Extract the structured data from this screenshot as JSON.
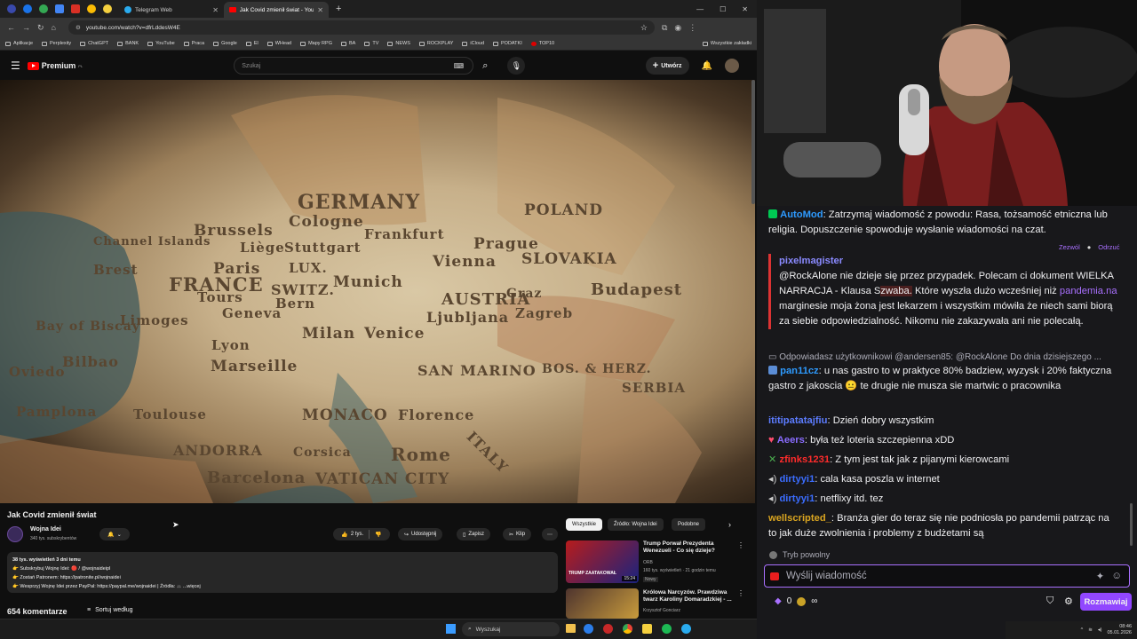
{
  "browser": {
    "tabs": [
      {
        "label": "Telegram Web"
      },
      {
        "label": "Jak Covid zmienił świat - YouTu..."
      }
    ],
    "new_tab": "+",
    "url": "youtube.com/watch?v=dfrLddesW4E",
    "bookmarks": [
      "Aplikacje",
      "Perplexity",
      "ChatGPT",
      "BANK",
      "YouTube",
      "Praca",
      "Google",
      "El",
      "WHead",
      "Mapy RPG",
      "BA",
      "TV",
      "NEWS",
      "ROCKPLAY",
      "iCloud",
      "PODATKI",
      "TOP10"
    ],
    "all_bookmarks": "Wszystkie zakładki"
  },
  "youtube": {
    "brand": "Premium",
    "brand_sup": "PL",
    "search_placeholder": "Szukaj",
    "create_label": "Utwórz",
    "map_labels": [
      "GERMANY",
      "Cologne",
      "Frankfurt",
      "Brussels",
      "Stuttgart",
      "Munich",
      "Paris",
      "FRANCE",
      "Tours",
      "Limoges",
      "Vienna",
      "Prague",
      "POLAND",
      "SLOVAKIA",
      "Budapest",
      "AUSTRIA",
      "SWITZ.",
      "Geneva",
      "Bern",
      "Milan",
      "Venice",
      "Ljubljana",
      "Zagreb",
      "Graz",
      "Marseille",
      "MONACO",
      "SAN MARINO",
      "Florence",
      "ANDORRA",
      "Barcelona",
      "VATICAN CITY",
      "Rome",
      "Corsica",
      "BOS. & HERZ.",
      "SERBIA",
      "ITALY",
      "Bilbao",
      "Oviedo",
      "Pamplona",
      "Bay of Biscay",
      "Brest",
      "Channel Islands",
      "Lyon",
      "Toulouse",
      "LUX.",
      "Liège"
    ],
    "video_title": "Jak Covid zmienił świat",
    "channel": "Wojna Idei",
    "subscribers": "340 tys. subskrybentów",
    "likes": "2 tys.",
    "share": "Udostępnij",
    "save": "Zapisz",
    "clip": "Klip",
    "views_line": "38 tys. wyświetleń  3 dni temu",
    "desc_lines": [
      "👉 Subskrybuj Wojnę Idei: 🔴 / @wojnaideipl",
      "👉 Zostań Patronem: https://patronite.pl/wojnaidei",
      "👉 Wesprzyj Wojnę Idei przez PayPal: https://paypal.me/wojnaidei   |   Źródła: ↓↓ ...więcej"
    ],
    "comments_count": "654 komentarze",
    "sort_label": "Sortuj według",
    "chips": [
      "Wszystkie",
      "Źródło: Wojna Idei",
      "Podobne"
    ],
    "related": [
      {
        "title": "Trump Porwał Prezydenta Wenezueli - Co się dzieje?",
        "channel": "ORB",
        "meta": "160 tys. wyświetleń · 21 godzin temu",
        "badge": "Nowy",
        "duration": "15:24",
        "thumb_text": "TRUMP ZAATAKOWAŁ"
      },
      {
        "title": "Królowa Narcyzów. Prawdziwa twarz Karoliny Domaradzkiej - ...",
        "channel": "Krzysztof Gonciarz",
        "meta": "",
        "badge": "",
        "duration": "",
        "thumb_text": ""
      }
    ]
  },
  "chat": {
    "automod": {
      "name": "AutoMod",
      "text": ": Zatrzymaj wiadomość z powodu: Rasa, tożsamość etniczna lub religia. Dopuszczenie spowoduje wysłanie wiadomości na czat.",
      "allow": "Zezwól",
      "deny": "Odrzuć"
    },
    "held": {
      "name": "pixelmagister",
      "text1": "@RockAlone nie dzieje się przez przypadek. Polecam ci dokument WIELKA NARRACJA - Klausa S",
      "highlight1": "zwaba.",
      "text2": " Które wyszła dużo wcześniej niż ",
      "highlight2": "pandemia.na",
      "text3": " marginesie moja żona jest lekarzem i wszystkim mówiła że niech sami biorą za siebie odpowiedzialność. Nikomu nie zakazywała ani nie polecałą."
    },
    "reply_ctx": "Odpowiadasz użytkownikowi @andersen85: @RockAlone Do dnia dzisiejszego ...",
    "messages": [
      {
        "name": "pan11cz",
        "color": "#2e9bff",
        "text": ": u nas gastro to w praktyce 80% badziew, wyzysk i 20% faktyczna gastro z jakoscia 😐 te drugie nie musza sie martwic o pracownika"
      },
      {
        "name": "ititipatatajfiu",
        "color": "#5c7cff",
        "text": ": Dzień dobry wszystkim"
      },
      {
        "name": "Aeers",
        "color": "#8a6cff",
        "text": ": była też loteria szczepienna xDD"
      },
      {
        "name": "zfinks1231",
        "color": "#ff2b2b",
        "text": ": Z tym jest tak jak z pijanymi kierowcami"
      },
      {
        "name": "dirtyyi1",
        "color": "#3b6dff",
        "text": ": cala kasa poszla w internet"
      },
      {
        "name": "dirtyyi1",
        "color": "#3b6dff",
        "text": ": netflixy itd. tez"
      },
      {
        "name": "wellscripted_",
        "color": "#daa520",
        "text": ": Branża gier do teraz się nie podniosła po pandemii patrząc na to jak duże zwolnienia i problemy z budżetami są"
      }
    ],
    "slow_mode": "Tryb powolny",
    "input_placeholder": "Wyślij wiadomość",
    "points": "0",
    "chat_button": "Rozmawiaj"
  },
  "taskbar": {
    "search": "Wyszukaj",
    "time": "08:46",
    "date": "05.01.2026"
  }
}
